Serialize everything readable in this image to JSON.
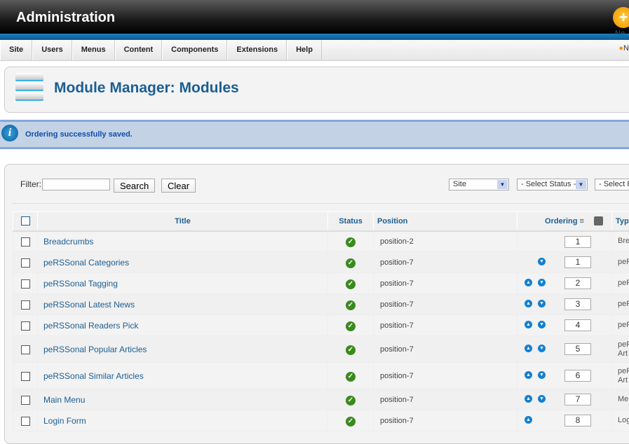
{
  "header": {
    "title": "Administration"
  },
  "menu": {
    "items": [
      "Site",
      "Users",
      "Menus",
      "Content",
      "Components",
      "Extensions",
      "Help"
    ],
    "user_fragment": "N"
  },
  "toolbar": {
    "title": "Module Manager: Modules",
    "new_label": "Ne"
  },
  "message": {
    "text": "Ordering successfully saved."
  },
  "filter": {
    "label": "Filter:",
    "value": "",
    "search_label": "Search",
    "clear_label": "Clear",
    "site_select": "Site",
    "status_select": "- Select Status -",
    "position_select": "- Select P"
  },
  "table": {
    "headers": {
      "title": "Title",
      "status": "Status",
      "position": "Position",
      "ordering": "Ordering",
      "type": "Typ"
    },
    "rows": [
      {
        "title": "Breadcrumbs",
        "status": "published",
        "position": "position-2",
        "order": "1",
        "up": false,
        "down": false,
        "type": "Bre"
      },
      {
        "title": "peRSSonal Categories",
        "status": "published",
        "position": "position-7",
        "order": "1",
        "up": false,
        "down": true,
        "type": "peR"
      },
      {
        "title": "peRSSonal Tagging",
        "status": "published",
        "position": "position-7",
        "order": "2",
        "up": true,
        "down": true,
        "type": "peR"
      },
      {
        "title": "peRSSonal Latest News",
        "status": "published",
        "position": "position-7",
        "order": "3",
        "up": true,
        "down": true,
        "type": "peR"
      },
      {
        "title": "peRSSonal Readers Pick",
        "status": "published",
        "position": "position-7",
        "order": "4",
        "up": true,
        "down": true,
        "type": "peR"
      },
      {
        "title": "peRSSonal Popular Articles",
        "status": "published",
        "position": "position-7",
        "order": "5",
        "up": true,
        "down": true,
        "type": "peR\nArt"
      },
      {
        "title": "peRSSonal Similar Articles",
        "status": "published",
        "position": "position-7",
        "order": "6",
        "up": true,
        "down": true,
        "type": "peR\nArt"
      },
      {
        "title": "Main Menu",
        "status": "published",
        "position": "position-7",
        "order": "7",
        "up": true,
        "down": true,
        "type": "Men"
      },
      {
        "title": "Login Form",
        "status": "published",
        "position": "position-7",
        "order": "8",
        "up": true,
        "down": false,
        "type": "Log"
      }
    ]
  }
}
